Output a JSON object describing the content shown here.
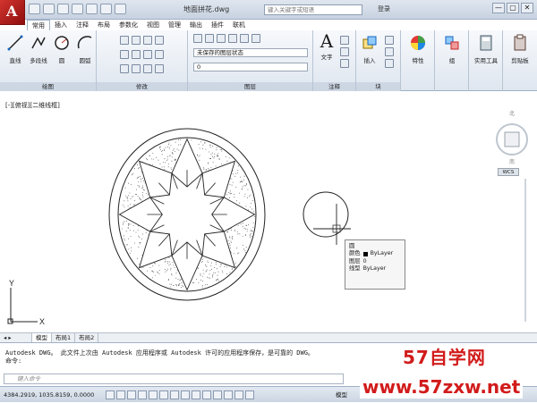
{
  "app": {
    "title": "地面拼花.dwg",
    "search_placeholder": "键入关键字或短语",
    "login": "登录",
    "window_buttons": [
      "—",
      "▢",
      "✕"
    ]
  },
  "tabs": [
    "常用",
    "插入",
    "注释",
    "布局",
    "参数化",
    "视图",
    "管理",
    "输出",
    "插件",
    "联机"
  ],
  "ribbon": {
    "draw": {
      "title": "绘图",
      "tools": [
        "直线",
        "多段线",
        "圆",
        "圆弧"
      ]
    },
    "modify": {
      "title": "修改"
    },
    "layers": {
      "title": "图层",
      "state": "未保存的图层状态",
      "current": "0"
    },
    "annotation": {
      "title": "注释",
      "text": "文字"
    },
    "block": {
      "title": "块",
      "insert": "插入"
    },
    "properties": {
      "label": "特性"
    },
    "groups": {
      "label": "组"
    },
    "utilities": {
      "label": "实用工具"
    },
    "clipboard": {
      "label": "剪贴板"
    }
  },
  "viewport": {
    "label": "[-][俯视][二维线框]",
    "wcs": "WCS"
  },
  "tooltip": {
    "title": "圆",
    "rows": [
      {
        "k": "颜色",
        "v": "ByLayer"
      },
      {
        "k": "图层",
        "v": "0"
      },
      {
        "k": "线型",
        "v": "ByLayer"
      }
    ]
  },
  "model_tabs": [
    "模型",
    "布局1",
    "布局2"
  ],
  "command": {
    "line1": "Autodesk DWG。  此文件上次由 Autodesk 应用程序或 Autodesk 许可的应用程序保存，是可靠的 DWG。",
    "line2": "命令:",
    "input_placeholder": "键入命令"
  },
  "status": {
    "coords": "4384.2919, 1035.8159, 0.0000",
    "model": "模型"
  },
  "watermark": {
    "brand": "57自学网",
    "url": "www.57zxw.net"
  },
  "colors": {
    "brand_red": "#d21b1b",
    "ribbon": "#dfe6ef"
  }
}
